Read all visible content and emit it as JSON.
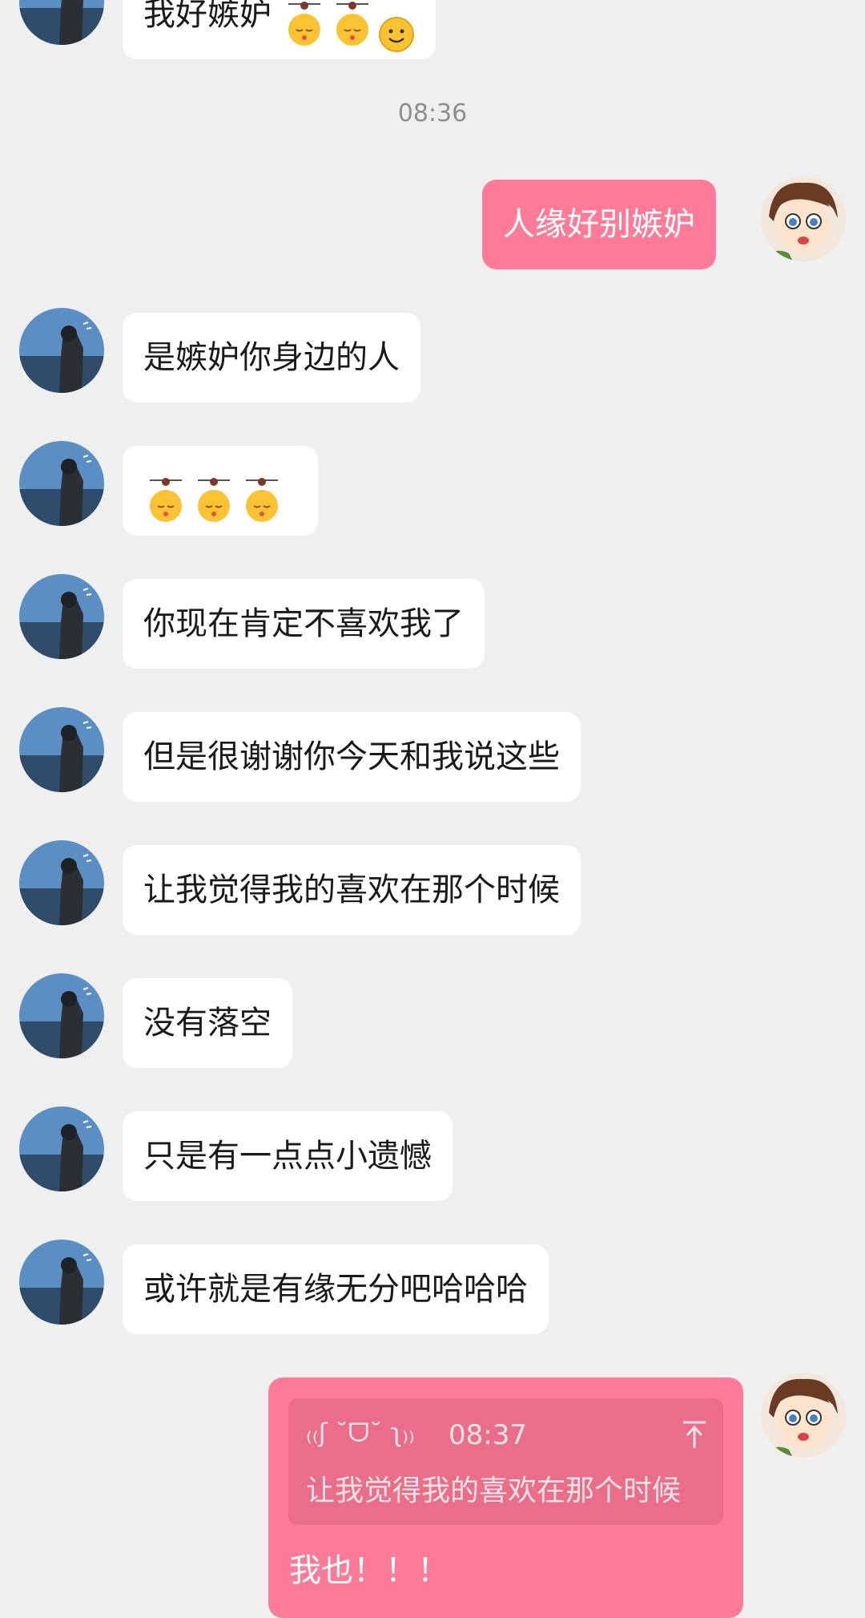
{
  "timestamp": "08:36",
  "messages": [
    {
      "sender": "other",
      "text": "我好嫉妒"
    },
    {
      "sender": "me",
      "text": "人缘好别嫉妒"
    },
    {
      "sender": "other",
      "text": "是嫉妒你身边的人"
    },
    {
      "sender": "other",
      "text": ""
    },
    {
      "sender": "other",
      "text": "你现在肯定不喜欢我了"
    },
    {
      "sender": "other",
      "text": "但是很谢谢你今天和我说这些"
    },
    {
      "sender": "other",
      "text": "让我觉得我的喜欢在那个时候"
    },
    {
      "sender": "other",
      "text": "没有落空"
    },
    {
      "sender": "other",
      "text": "只是有一点点小遗憾"
    },
    {
      "sender": "other",
      "text": "或许就是有缘无分吧哈哈哈"
    }
  ],
  "reply": {
    "quoted_sender": "₍₍ʃ ˘ᗜ˘ ʅ₎₎",
    "quoted_time": "08:37",
    "quoted_text": "让我觉得我的喜欢在那个时候",
    "text": "我也！！！"
  },
  "colors": {
    "background": "#efefef",
    "incoming_bubble": "#ffffff",
    "outgoing_bubble": "#fd7a98",
    "quote_box": "#ea6d89"
  },
  "icons": [
    "sleepy-emoji-icon",
    "smile-emoji-icon",
    "pin-icon"
  ]
}
